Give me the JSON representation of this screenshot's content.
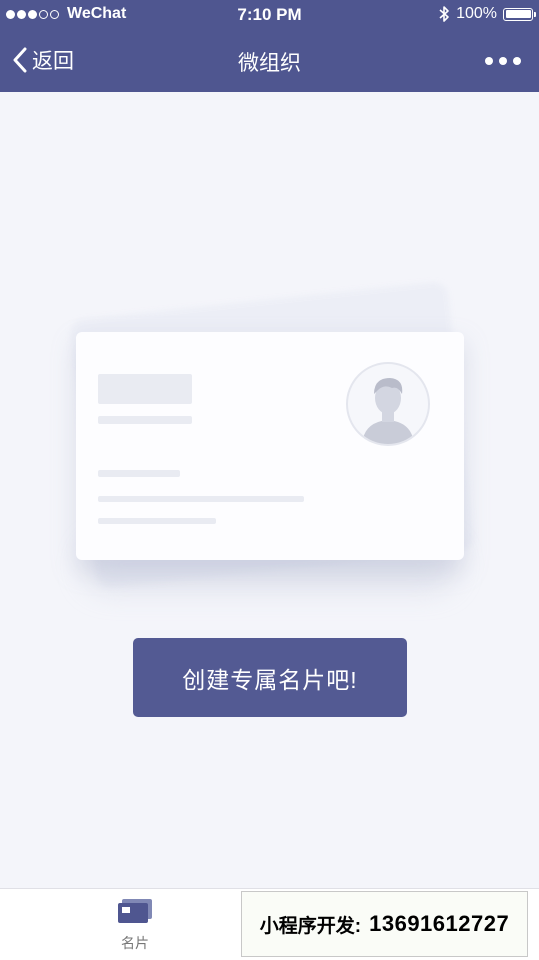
{
  "status_bar": {
    "carrier": "WeChat",
    "time": "7:10 PM",
    "battery": "100%",
    "signal_bars_filled": 3,
    "signal_bars_total": 5
  },
  "nav": {
    "back_label": "返回",
    "title": "微组织"
  },
  "main": {
    "create_button_label": "创建专属名片吧!"
  },
  "tab_bar": {
    "tabs": [
      {
        "label": "名片",
        "icon": "card-icon"
      }
    ]
  },
  "overlay": {
    "label": "小程序开发:",
    "phone": "13691612727"
  },
  "colors": {
    "primary": "#4f5690",
    "button": "#535a93",
    "background": "#f4f5fa"
  }
}
